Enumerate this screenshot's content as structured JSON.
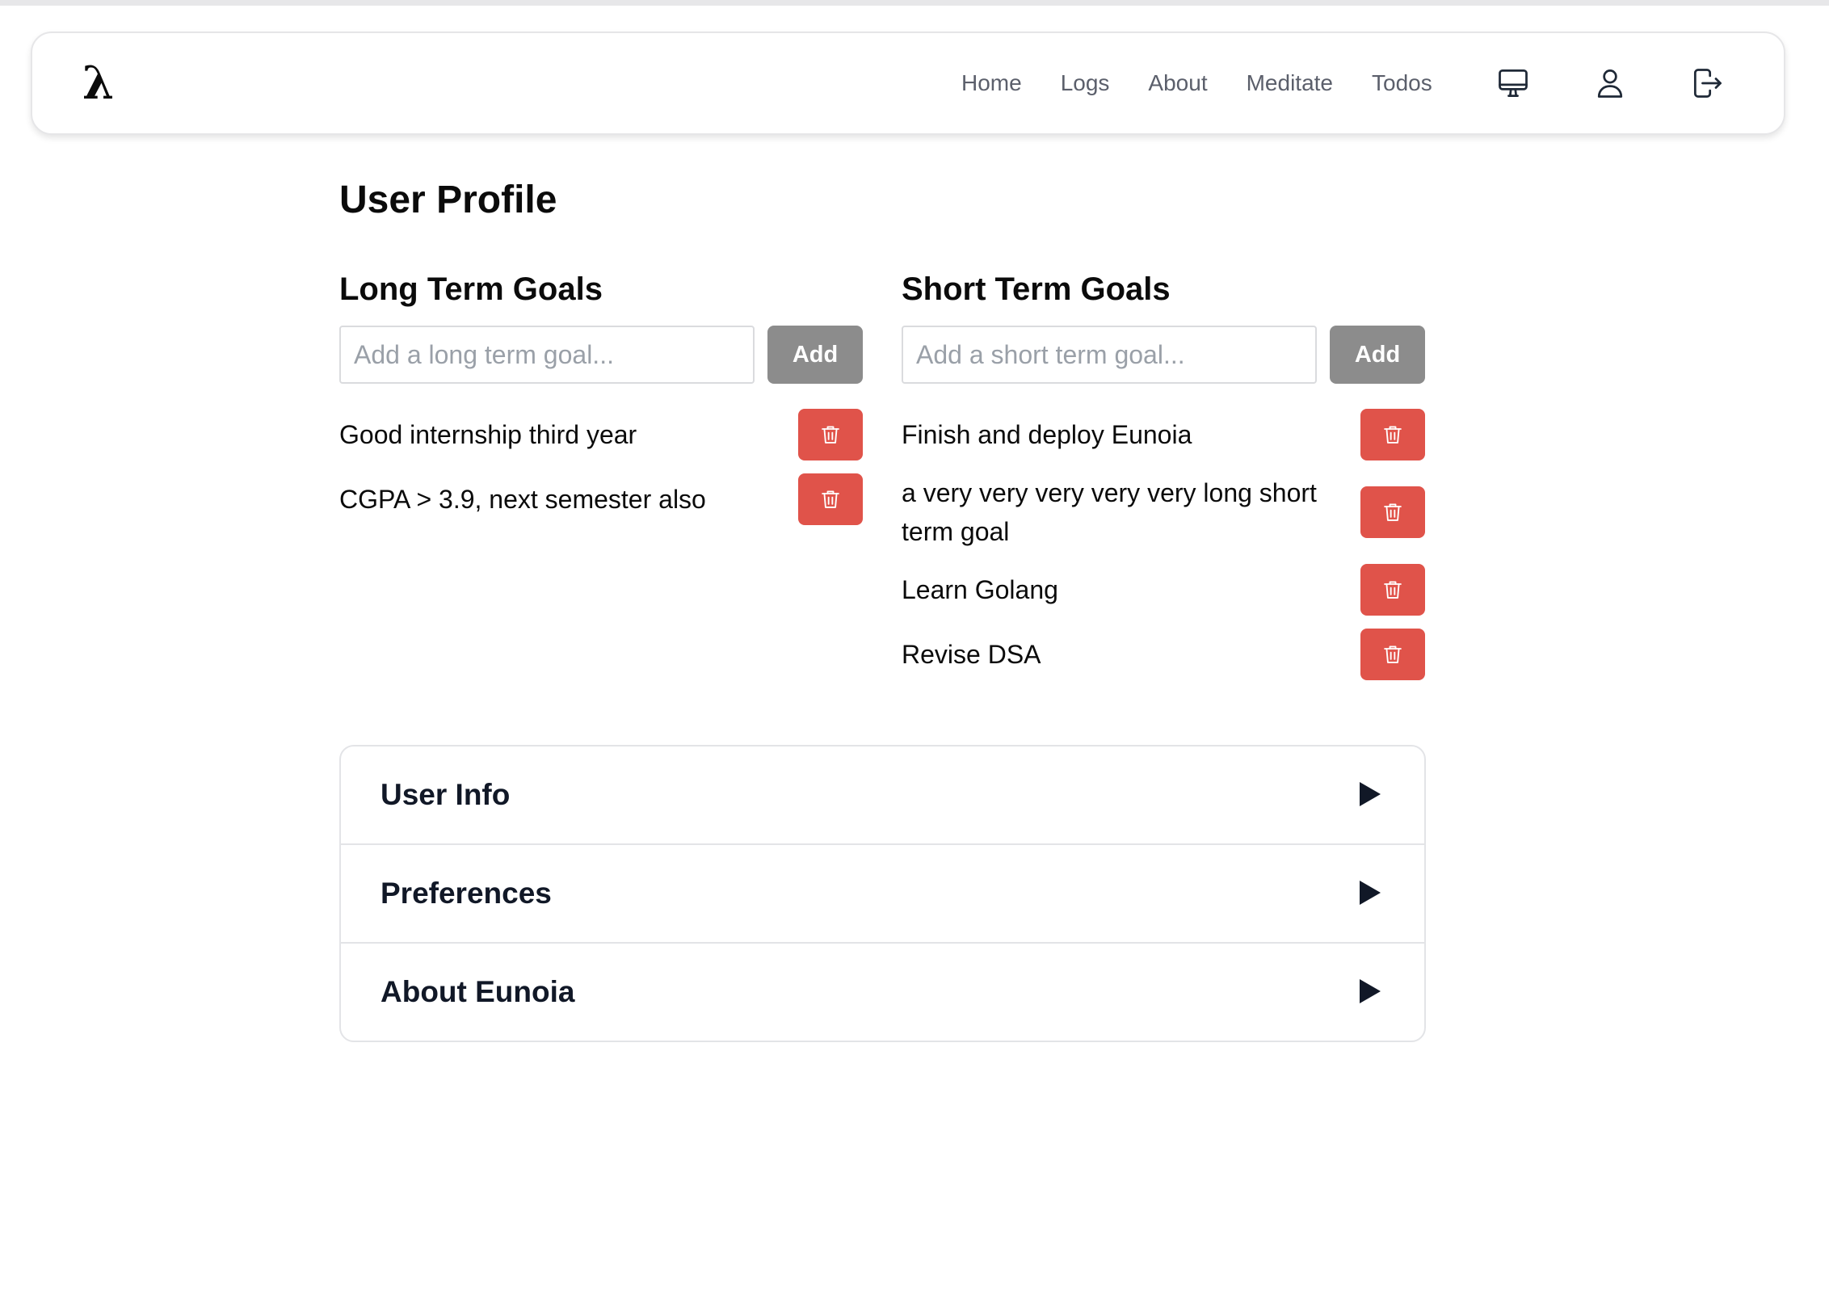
{
  "nav": {
    "logo": "λ",
    "links": [
      "Home",
      "Logs",
      "About",
      "Meditate",
      "Todos"
    ],
    "icons": [
      "monitor-icon",
      "user-icon",
      "logout-icon"
    ]
  },
  "page": {
    "title": "User Profile"
  },
  "long_term": {
    "heading": "Long Term Goals",
    "placeholder": "Add a long term goal...",
    "value": "",
    "add_label": "Add",
    "items": [
      "Good internship third year",
      "CGPA > 3.9, next semester also"
    ]
  },
  "short_term": {
    "heading": "Short Term Goals",
    "placeholder": "Add a short term goal...",
    "value": "",
    "add_label": "Add",
    "items": [
      "Finish and deploy Eunoia",
      "a very very very very very long short term goal",
      "Learn Golang",
      "Revise DSA"
    ]
  },
  "accordion": {
    "sections": [
      "User Info",
      "Preferences",
      "About Eunoia"
    ],
    "arrow_icon": "triangle-right-icon"
  },
  "colors": {
    "delete_button": "#e0534a",
    "add_button": "#8c8c8c",
    "nav_link": "#5b5f6b",
    "accordion_text": "#111827"
  }
}
